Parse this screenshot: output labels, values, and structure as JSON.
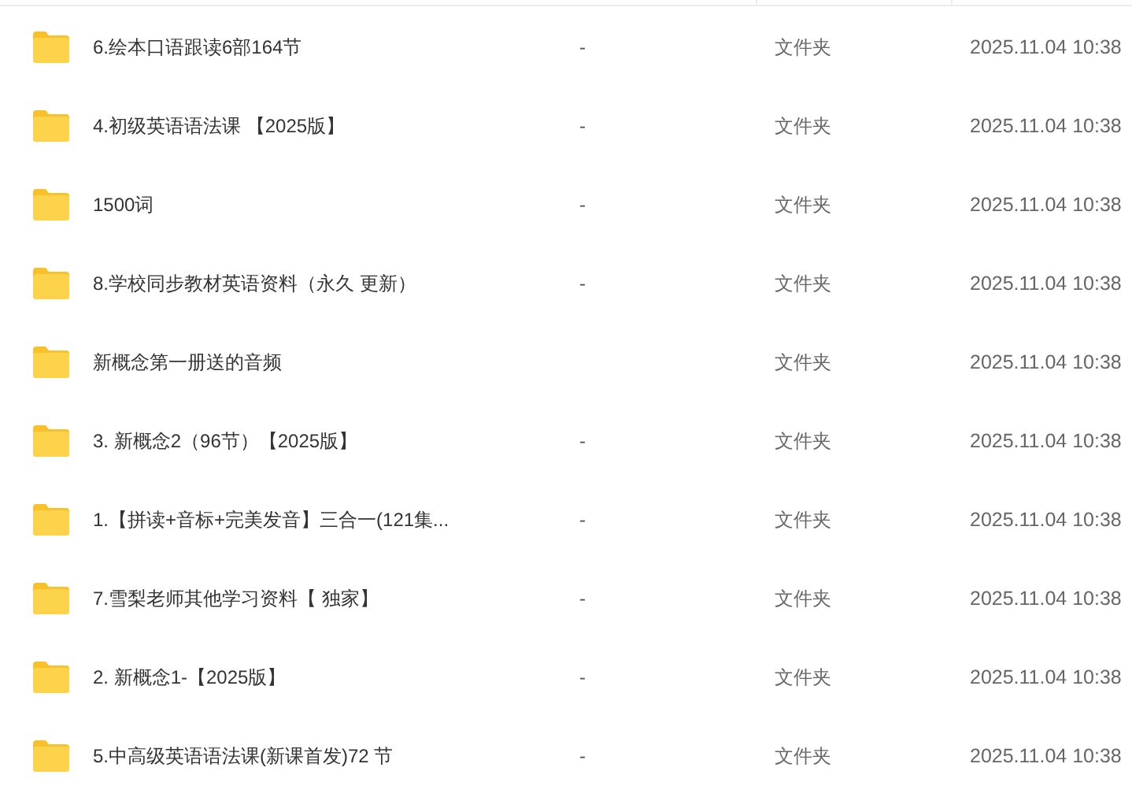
{
  "files": [
    {
      "name": "6.绘本口语跟读6部164节",
      "size": "-",
      "type": "文件夹",
      "modified": "2025.11.04 10:38"
    },
    {
      "name": "4.初级英语语法课 【2025版】",
      "size": "-",
      "type": "文件夹",
      "modified": "2025.11.04 10:38"
    },
    {
      "name": "1500词",
      "size": "-",
      "type": "文件夹",
      "modified": "2025.11.04 10:38"
    },
    {
      "name": "8.学校同步教材英语资料（永久 更新）",
      "size": "-",
      "type": "文件夹",
      "modified": "2025.11.04 10:38"
    },
    {
      "name": "新概念第一册送的音频",
      "type": "文件夹",
      "modified": "2025.11.04 10:38"
    },
    {
      "name": "3. 新概念2（96节）【2025版】",
      "size": "-",
      "type": "文件夹",
      "modified": "2025.11.04 10:38"
    },
    {
      "name": "1.【拼读+音标+完美发音】三合一(121集...",
      "size": "-",
      "type": "文件夹",
      "modified": "2025.11.04 10:38"
    },
    {
      "name": "7.雪梨老师其他学习资料【 独家】",
      "size": "-",
      "type": "文件夹",
      "modified": "2025.11.04 10:38"
    },
    {
      "name": "2. 新概念1-【2025版】",
      "size": "-",
      "type": "文件夹",
      "modified": "2025.11.04 10:38"
    },
    {
      "name": "5.中高级英语语法课(新课首发)72 节",
      "size": "-",
      "type": "文件夹",
      "modified": "2025.11.04 10:38"
    }
  ]
}
